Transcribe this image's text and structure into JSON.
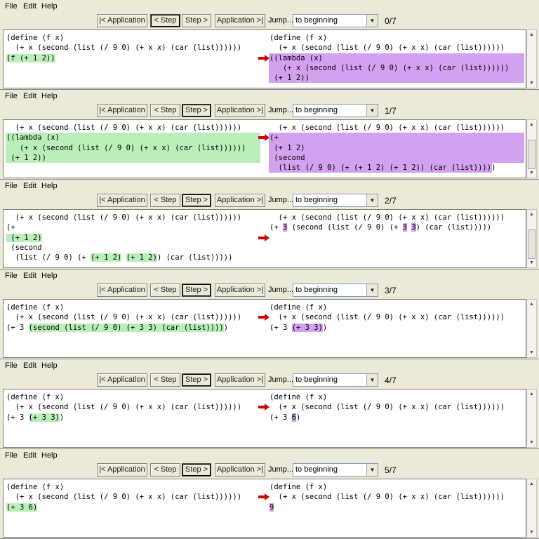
{
  "menu": {
    "file": "File",
    "edit": "Edit",
    "help": "Help"
  },
  "toolbar": {
    "prev_app": "|< Application",
    "prev_step": "< Step",
    "next_step": "Step >",
    "next_app": "Application >|",
    "jump": "Jump...",
    "jump_selected": "to beginning"
  },
  "colors": {
    "redex_highlight": "#b9f0b9",
    "result_highlight": "#d4a0f0",
    "arrow": "#cc0000",
    "background": "#ece9d8"
  },
  "icons": {
    "step_arrow": "red-arrow-icon",
    "dropdown": "chevron-down-icon"
  },
  "steps": [
    {
      "counter": "0/7",
      "left_lines": [
        "(define (f x)",
        "  (+ x (second (list (/ 9 0) (+ x x) (car (list))))))",
        "(f (+ 1 2))"
      ],
      "right_lines": [
        "(define (f x)",
        "  (+ x (second (list (/ 9 0) (+ x x) (car (list))))))",
        "((lambda (x)",
        "   (+ x (second (list (/ 9 0) (+ x x) (car (list))))))",
        " (+ 1 2))"
      ]
    },
    {
      "counter": "1/7",
      "left_lines": [
        "  (+ x (second (list (/ 9 0) (+ x x) (car (list))))))",
        "((lambda (x)",
        "   (+ x (second (list (/ 9 0) (+ x x) (car (list))))))",
        " (+ 1 2))"
      ],
      "right_lines": [
        "  (+ x (second (list (/ 9 0) (+ x x) (car (list))))))",
        "(+",
        " (+ 1 2)",
        " (second",
        "  (list (/ 9 0) (+ (+ 1 2) (+ 1 2)) (car (list)))))"
      ]
    },
    {
      "counter": "2/7",
      "left_lines": [
        "  (+ x (second (list (/ 9 0) (+ x x) (car (list))))))",
        "(+",
        " (+ 1 2)",
        " (second",
        "  (list (/ 9 0) (+ ",
        "(+ 1 2)",
        " ",
        "(+ 1 2)",
        ") (car (list)))))"
      ],
      "right_lines": [
        "  (+ x (second (list (/ 9 0) (+ x x) (car (list))))))",
        "(+ ",
        "3",
        " (second (list (/ 9 0) (+ ",
        "3",
        " ",
        "3",
        ") (car (list)))))"
      ]
    },
    {
      "counter": "3/7",
      "left_lines": [
        "(define (f x)",
        "  (+ x (second (list (/ 9 0) (+ x x) (car (list))))))",
        "(+ 3 ",
        "(second (list (/ 9 0) (+ 3 3) (car (list))))",
        ")"
      ],
      "right_lines": [
        "(define (f x)",
        "  (+ x (second (list (/ 9 0) (+ x x) (car (list))))))",
        "(+ 3 ",
        "(+ 3 3)",
        ")"
      ]
    },
    {
      "counter": "4/7",
      "left_lines": [
        "(define (f x)",
        "  (+ x (second (list (/ 9 0) (+ x x) (car (list))))))",
        "(+ 3 ",
        "(+ 3 3)",
        ")"
      ],
      "right_lines": [
        "(define (f x)",
        "  (+ x (second (list (/ 9 0) (+ x x) (car (list))))))",
        "(+ 3 ",
        "6",
        ")"
      ]
    },
    {
      "counter": "5/7",
      "left_lines": [
        "(define (f x)",
        "  (+ x (second (list (/ 9 0) (+ x x) (car (list))))))",
        "(+ 3 6)"
      ],
      "right_lines": [
        "(define (f x)",
        "  (+ x (second (list (/ 9 0) (+ x x) (car (list))))))",
        "9"
      ]
    }
  ]
}
